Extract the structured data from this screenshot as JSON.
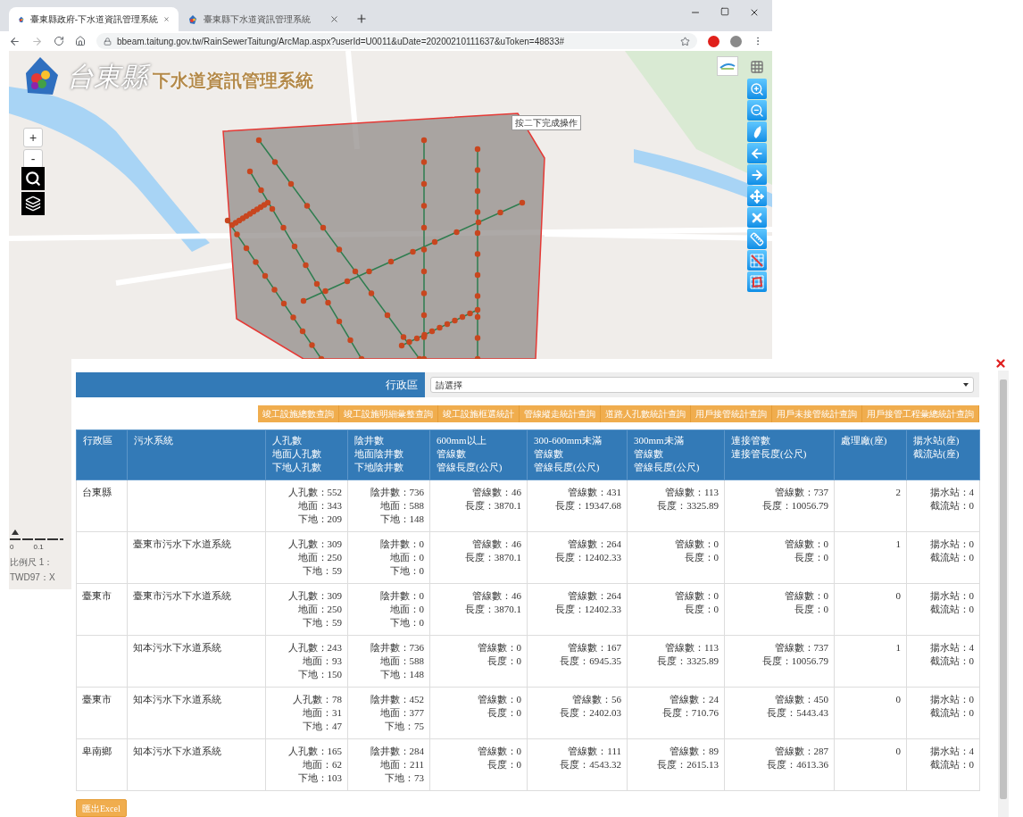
{
  "browser": {
    "tabs": [
      {
        "title": "臺東縣政府-下水道資訊管理系統",
        "selected": true
      },
      {
        "title": "臺東縣下水道資訊管理系統",
        "selected": false
      }
    ],
    "url": "bbeam.taitung.gov.tw/RainSewerTaitung/ArcMap.aspx?userId=U0011&uDate=20200210111637&uToken=48833#"
  },
  "map": {
    "logo": {
      "mark": "台東縣",
      "title": "下水道資訊管理系統"
    },
    "zoom_buttons": [
      "+",
      "-"
    ],
    "tooltip": "按二下完成操作",
    "scale": {
      "ticks": [
        "0",
        "0.1"
      ],
      "ratio": "比例尺 1：",
      "coords": "TWD97：X"
    }
  },
  "panel": {
    "filter": {
      "label": "行政區",
      "value": "請選擇"
    },
    "query_buttons": [
      "竣工設施總數查詢",
      "竣工設施明細彙整查詢",
      "竣工設施框選統計",
      "管線縱走統計查詢",
      "道路人孔數統計查詢",
      "用戶接管統計查詢",
      "用戶未接管統計查詢",
      "用戶接管工程彙總統計查詢"
    ],
    "table": {
      "columns": [
        [
          "行政區"
        ],
        [
          "污水系統"
        ],
        [
          "人孔數",
          "地面人孔數",
          "下地人孔數"
        ],
        [
          "陰井數",
          "地面陰井數",
          "下地陰井數"
        ],
        [
          "600mm以上",
          "管線數",
          "管線長度(公尺)"
        ],
        [
          "300-600mm未滿",
          "管線數",
          "管線長度(公尺)"
        ],
        [
          "300mm未滿",
          "管線數",
          "管線長度(公尺)"
        ],
        [
          "連接管數",
          "連接管長度(公尺)"
        ],
        [
          "處理廠(座)"
        ],
        [
          "揚水站(座)",
          "截流站(座)"
        ]
      ],
      "rows": [
        {
          "district": "台東縣",
          "manholes": [
            "人孔數：552",
            "地面：343",
            "下地：209"
          ],
          "catch_basins": [
            "陰井數：736",
            "地面：588",
            "下地：148"
          ],
          "pipes_600_up": [
            "管線數：46",
            "長度：3870.1"
          ],
          "pipes_300_600": [
            "管線數：431",
            "長度：19347.68"
          ],
          "pipes_under_300": [
            "管線數：113",
            "長度：3325.89"
          ],
          "connections": [
            "管線數：737",
            "長度：10056.79"
          ],
          "plants": [
            "2"
          ],
          "stations": [
            "揚水站：4",
            "截流站：0"
          ]
        },
        {
          "system": "臺東市污水下水道系統",
          "manholes": [
            "人孔數：309",
            "地面：250",
            "下地：59"
          ],
          "catch_basins": [
            "陰井數：0",
            "地面：0",
            "下地：0"
          ],
          "pipes_600_up": [
            "管線數：46",
            "長度：3870.1"
          ],
          "pipes_300_600": [
            "管線數：264",
            "長度：12402.33"
          ],
          "pipes_under_300": [
            "管線數：0",
            "長度：0"
          ],
          "connections": [
            "管線數：0",
            "長度：0"
          ],
          "plants": [
            "1"
          ],
          "stations": [
            "揚水站：0",
            "截流站：0"
          ]
        },
        {
          "district": "臺東市",
          "system": "臺東市污水下水道系統",
          "manholes": [
            "人孔數：309",
            "地面：250",
            "下地：59"
          ],
          "catch_basins": [
            "陰井數：0",
            "地面：0",
            "下地：0"
          ],
          "pipes_600_up": [
            "管線數：46",
            "長度：3870.1"
          ],
          "pipes_300_600": [
            "管線數：264",
            "長度：12402.33"
          ],
          "pipes_under_300": [
            "管線數：0",
            "長度：0"
          ],
          "connections": [
            "管線數：0",
            "長度：0"
          ],
          "plants": [
            "0"
          ],
          "stations": [
            "揚水站：0",
            "截流站：0"
          ]
        },
        {
          "system": "知本污水下水道系統",
          "manholes": [
            "人孔數：243",
            "地面：93",
            "下地：150"
          ],
          "catch_basins": [
            "陰井數：736",
            "地面：588",
            "下地：148"
          ],
          "pipes_600_up": [
            "管線數：0",
            "長度：0"
          ],
          "pipes_300_600": [
            "管線數：167",
            "長度：6945.35"
          ],
          "pipes_under_300": [
            "管線數：113",
            "長度：3325.89"
          ],
          "connections": [
            "管線數：737",
            "長度：10056.79"
          ],
          "plants": [
            "1"
          ],
          "stations": [
            "揚水站：4",
            "截流站：0"
          ]
        },
        {
          "district": "臺東市",
          "system": "知本污水下水道系統",
          "manholes": [
            "人孔數：78",
            "地面：31",
            "下地：47"
          ],
          "catch_basins": [
            "陰井數：452",
            "地面：377",
            "下地：75"
          ],
          "pipes_600_up": [
            "管線數：0",
            "長度：0"
          ],
          "pipes_300_600": [
            "管線數：56",
            "長度：2402.03"
          ],
          "pipes_under_300": [
            "管線數：24",
            "長度：710.76"
          ],
          "connections": [
            "管線數：450",
            "長度：5443.43"
          ],
          "plants": [
            "0"
          ],
          "stations": [
            "揚水站：0",
            "截流站：0"
          ]
        },
        {
          "district": "卑南鄉",
          "system": "知本污水下水道系統",
          "manholes": [
            "人孔數：165",
            "地面：62",
            "下地：103"
          ],
          "catch_basins": [
            "陰井數：284",
            "地面：211",
            "下地：73"
          ],
          "pipes_600_up": [
            "管線數：0",
            "長度：0"
          ],
          "pipes_300_600": [
            "管線數：111",
            "長度：4543.32"
          ],
          "pipes_under_300": [
            "管線數：89",
            "長度：2615.13"
          ],
          "connections": [
            "管線數：287",
            "長度：4613.36"
          ],
          "plants": [
            "0"
          ],
          "stations": [
            "揚水站：4",
            "截流站：0"
          ]
        }
      ]
    },
    "export_button": "匯出Excel"
  }
}
